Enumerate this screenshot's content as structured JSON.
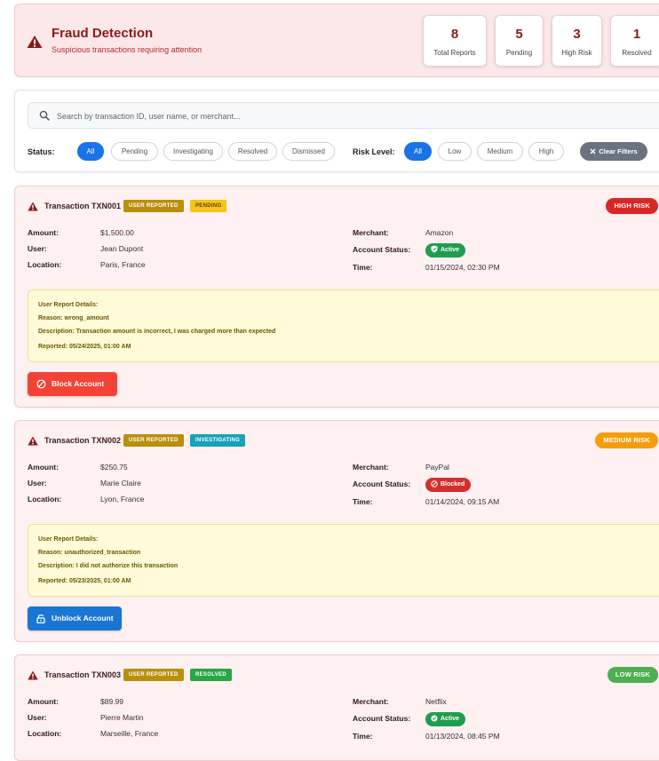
{
  "header": {
    "title": "Fraud Detection",
    "subtitle": "Suspicious transactions requiring attention",
    "stats": [
      {
        "value": "8",
        "label": "Total Reports"
      },
      {
        "value": "5",
        "label": "Pending"
      },
      {
        "value": "3",
        "label": "High Risk"
      },
      {
        "value": "1",
        "label": "Resolved"
      }
    ]
  },
  "filters": {
    "search_placeholder": "Search by transaction ID, user name, or merchant...",
    "status_label": "Status:",
    "status_options": [
      "All",
      "Pending",
      "Investigating",
      "Resolved",
      "Dismissed"
    ],
    "status_selected": "All",
    "risk_label": "Risk Level:",
    "risk_options": [
      "All",
      "Low",
      "Medium",
      "High"
    ],
    "risk_selected": "All",
    "clear_label": "Clear Filters"
  },
  "field_labels": {
    "amount": "Amount:",
    "user": "User:",
    "location": "Location:",
    "merchant": "Merchant:",
    "account_status": "Account Status:",
    "time": "Time:"
  },
  "transactions": [
    {
      "title": "Transaction TXN001",
      "source_badge": "USER REPORTED",
      "status_badge": "PENDING",
      "risk": "HIGH RISK",
      "amount": "$1,500.00",
      "user": "Jean Dupont",
      "location": "Paris, France",
      "merchant": "Amazon",
      "account_status": "Active",
      "time": "01/15/2024, 02:30 PM",
      "report": {
        "heading": "User Report Details:",
        "reason": "Reason: wrong_amount",
        "description": "Description: Transaction amount is incorrect, I was charged more than expected",
        "reported": "Reported: 05/24/2025, 01:00 AM"
      },
      "action": "Block Account"
    },
    {
      "title": "Transaction TXN002",
      "source_badge": "USER REPORTED",
      "status_badge": "INVESTIGATING",
      "risk": "MEDIUM RISK",
      "amount": "$250.75",
      "user": "Marie Claire",
      "location": "Lyon, France",
      "merchant": "PayPal",
      "account_status": "Blocked",
      "time": "01/14/2024, 09:15 AM",
      "report": {
        "heading": "User Report Details:",
        "reason": "Reason: unauthorized_transaction",
        "description": "Description: I did not authorize this transaction",
        "reported": "Reported: 05/23/2025, 01:00 AM"
      },
      "action": "Unblock Account"
    },
    {
      "title": "Transaction TXN003",
      "source_badge": "USER REPORTED",
      "status_badge": "RESOLVED",
      "risk": "LOW RISK",
      "amount": "$89.99",
      "user": "Pierre Martin",
      "location": "Marseille, France",
      "merchant": "Netflix",
      "account_status": "Active",
      "time": "01/13/2024, 08:45 PM"
    }
  ],
  "colors": {
    "header_bg": "#fde8e9",
    "title_red": "#8b1a1a",
    "primary_blue": "#1a73e8",
    "user_reported_badge": "#b8900b",
    "pending_badge": "#f5c518",
    "investigating_badge": "#17a2b8",
    "resolved_badge": "#28a745",
    "high_risk": "#dc2626",
    "medium_risk": "#f59e0b",
    "low_risk": "#4caf50",
    "active_status": "#1f9d4f",
    "blocked_status": "#d32f2f",
    "block_button": "#f44336",
    "unblock_button": "#1976d2"
  }
}
